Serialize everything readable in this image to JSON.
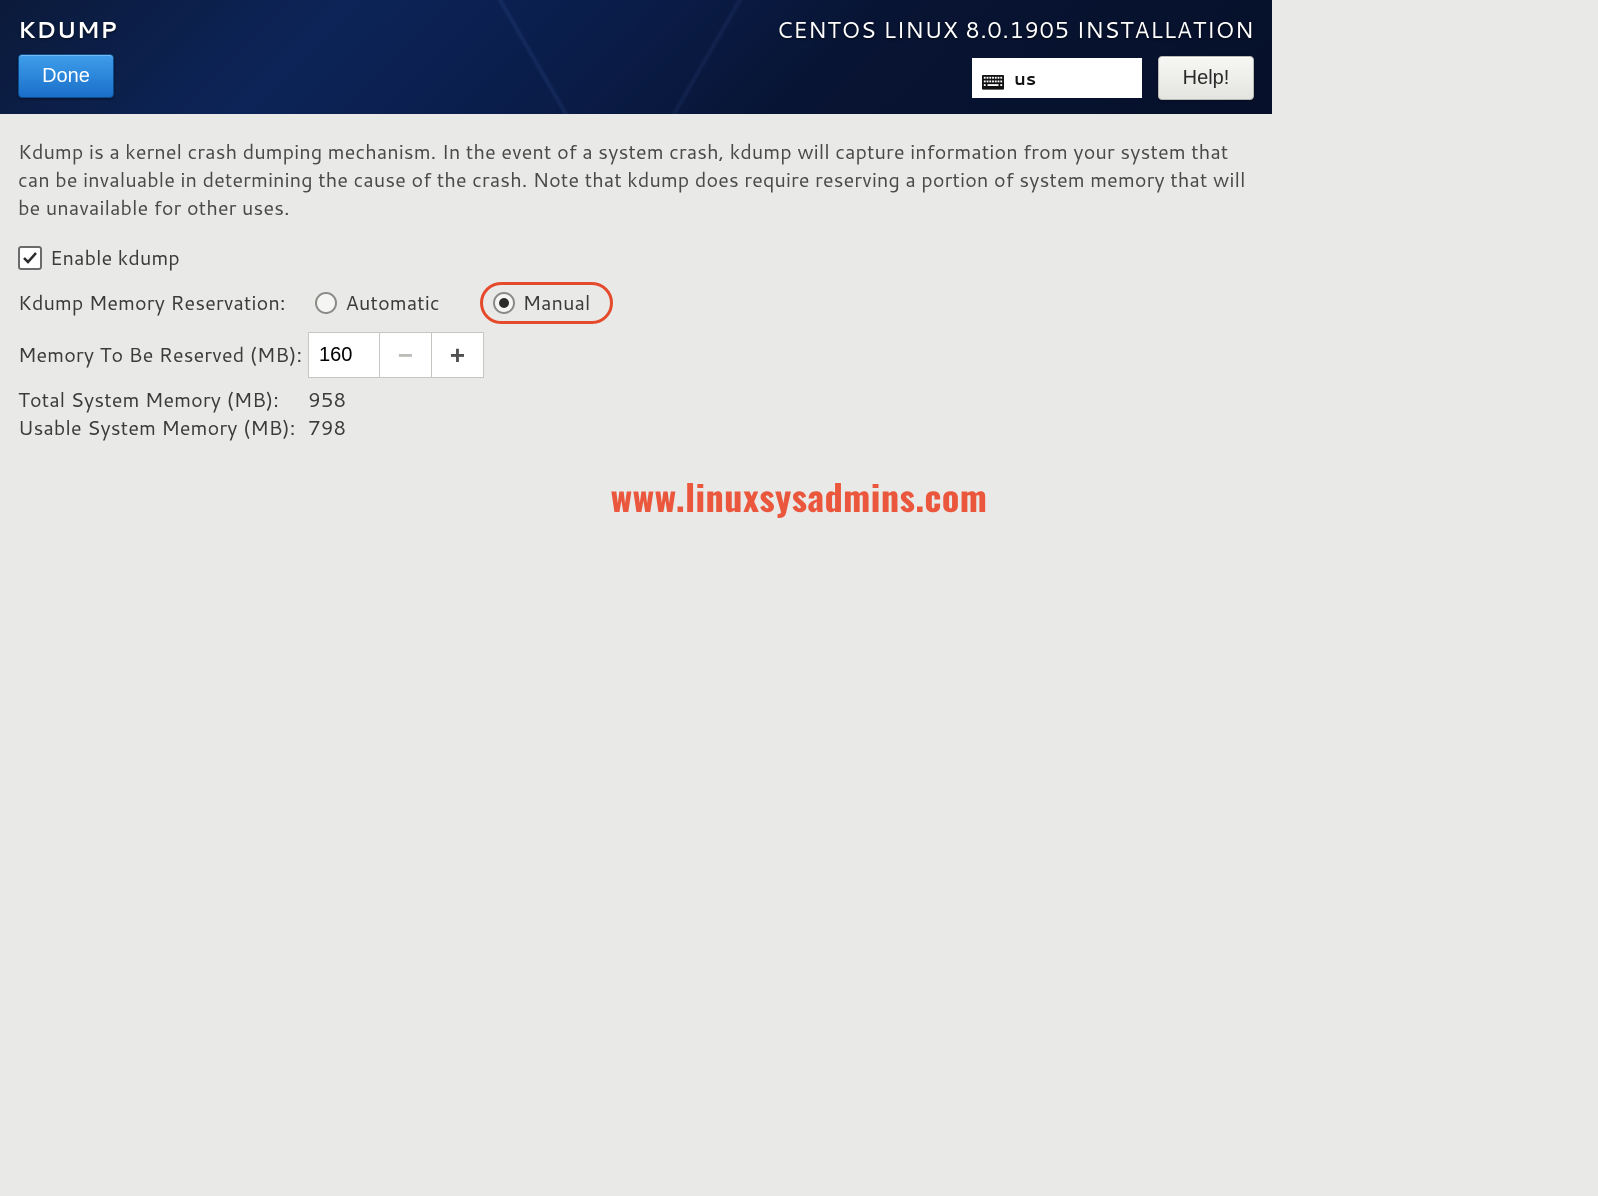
{
  "header": {
    "page_title": "KDUMP",
    "done_label": "Done",
    "install_title": "CENTOS LINUX 8.0.1905 INSTALLATION",
    "keyboard_layout": "us",
    "help_label": "Help!"
  },
  "main": {
    "description": "Kdump is a kernel crash dumping mechanism. In the event of a system crash, kdump will capture information from your system that can be invaluable in determining the cause of the crash. Note that kdump does require reserving a portion of system memory that will be unavailable for other uses.",
    "enable_label": "Enable kdump",
    "enable_checked": true,
    "reservation_label": "Kdump Memory Reservation:",
    "radio_automatic": "Automatic",
    "radio_manual": "Manual",
    "reservation_mode": "manual",
    "memory_reserve_label": "Memory To Be Reserved (MB):",
    "memory_reserve_value": "160",
    "total_memory_label": "Total System Memory (MB):",
    "total_memory_value": "958",
    "usable_memory_label": "Usable System Memory (MB):",
    "usable_memory_value": "798"
  },
  "watermark": "www.linuxsysadmins.com"
}
